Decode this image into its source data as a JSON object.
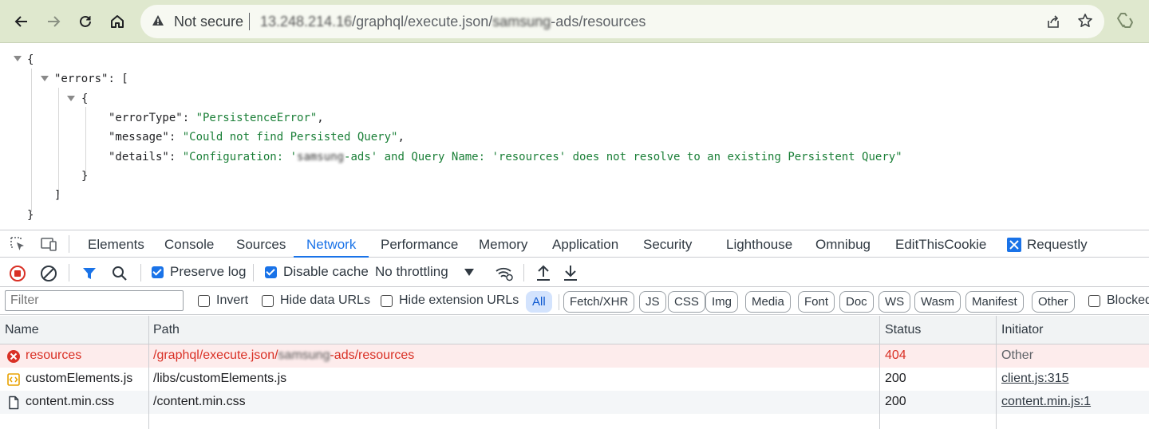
{
  "browser": {
    "security_label": "Not secure",
    "url_prefix": "13.248.214.16",
    "url_mid": "/graphql/execute.json/",
    "url_redacted": "samsung",
    "url_suffix": "-ads/resources",
    "icons": [
      "back-icon",
      "forward-icon",
      "reload-icon",
      "home-icon",
      "warning-icon",
      "share-icon",
      "star-icon",
      "extension-icon"
    ]
  },
  "json_view": {
    "open_brace": "{",
    "errors_key": "\"errors\"",
    "colon_bracket": ": [",
    "inner_open": "{",
    "lines": [
      {
        "key": "\"errorType\"",
        "value": "\"PersistenceError\"",
        "trail": ","
      },
      {
        "key": "\"message\"",
        "value": "\"Could not find Persisted Query\"",
        "trail": ","
      },
      {
        "key": "\"details\"",
        "value_pre": "\"Configuration: '",
        "value_redacted": "samsung",
        "value_post": "-ads' and Query Name: 'resources' does not resolve to an existing Persistent Query\"",
        "trail": ""
      }
    ],
    "inner_close": "}",
    "array_close": "]",
    "close_brace": "}"
  },
  "devtools": {
    "tabs": [
      "Elements",
      "Console",
      "Sources",
      "Network",
      "Performance",
      "Memory",
      "Application",
      "Security",
      "Lighthouse",
      "Omnibug",
      "EditThisCookie",
      "Requestly"
    ],
    "active_tab": "Network",
    "network_toolbar": {
      "preserve_log": "Preserve log",
      "preserve_log_checked": true,
      "disable_cache": "Disable cache",
      "disable_cache_checked": true,
      "throttling": "No throttling"
    },
    "filter": {
      "placeholder": "Filter",
      "invert": "Invert",
      "hide_data_urls": "Hide data URLs",
      "hide_extension_urls": "Hide extension URLs",
      "types": [
        "All",
        "Fetch/XHR",
        "JS",
        "CSS",
        "Img",
        "Media",
        "Font",
        "Doc",
        "WS",
        "Wasm",
        "Manifest",
        "Other"
      ],
      "active_type": "All",
      "blocked": "Blocked"
    },
    "table": {
      "headers": {
        "name": "Name",
        "path": "Path",
        "status": "Status",
        "initiator": "Initiator"
      },
      "rows": [
        {
          "name": "resources",
          "path_pre": "/graphql/execute.json/",
          "path_redacted": "samsung",
          "path_post": "-ads/resources",
          "status": "404",
          "initiator": "Other",
          "kind": "error"
        },
        {
          "name": "customElements.js",
          "path": "/libs/customElements.js",
          "status": "200",
          "initiator": "client.js:315",
          "kind": "script"
        },
        {
          "name": "content.min.css",
          "path": "/content.min.css",
          "status": "200",
          "initiator": "content.min.js:1",
          "kind": "document"
        }
      ]
    }
  },
  "colors": {
    "toolbar_bg": "#dfe8ce",
    "accent": "#1a73e8",
    "error": "#d93025",
    "json_string": "#1a7f37"
  }
}
